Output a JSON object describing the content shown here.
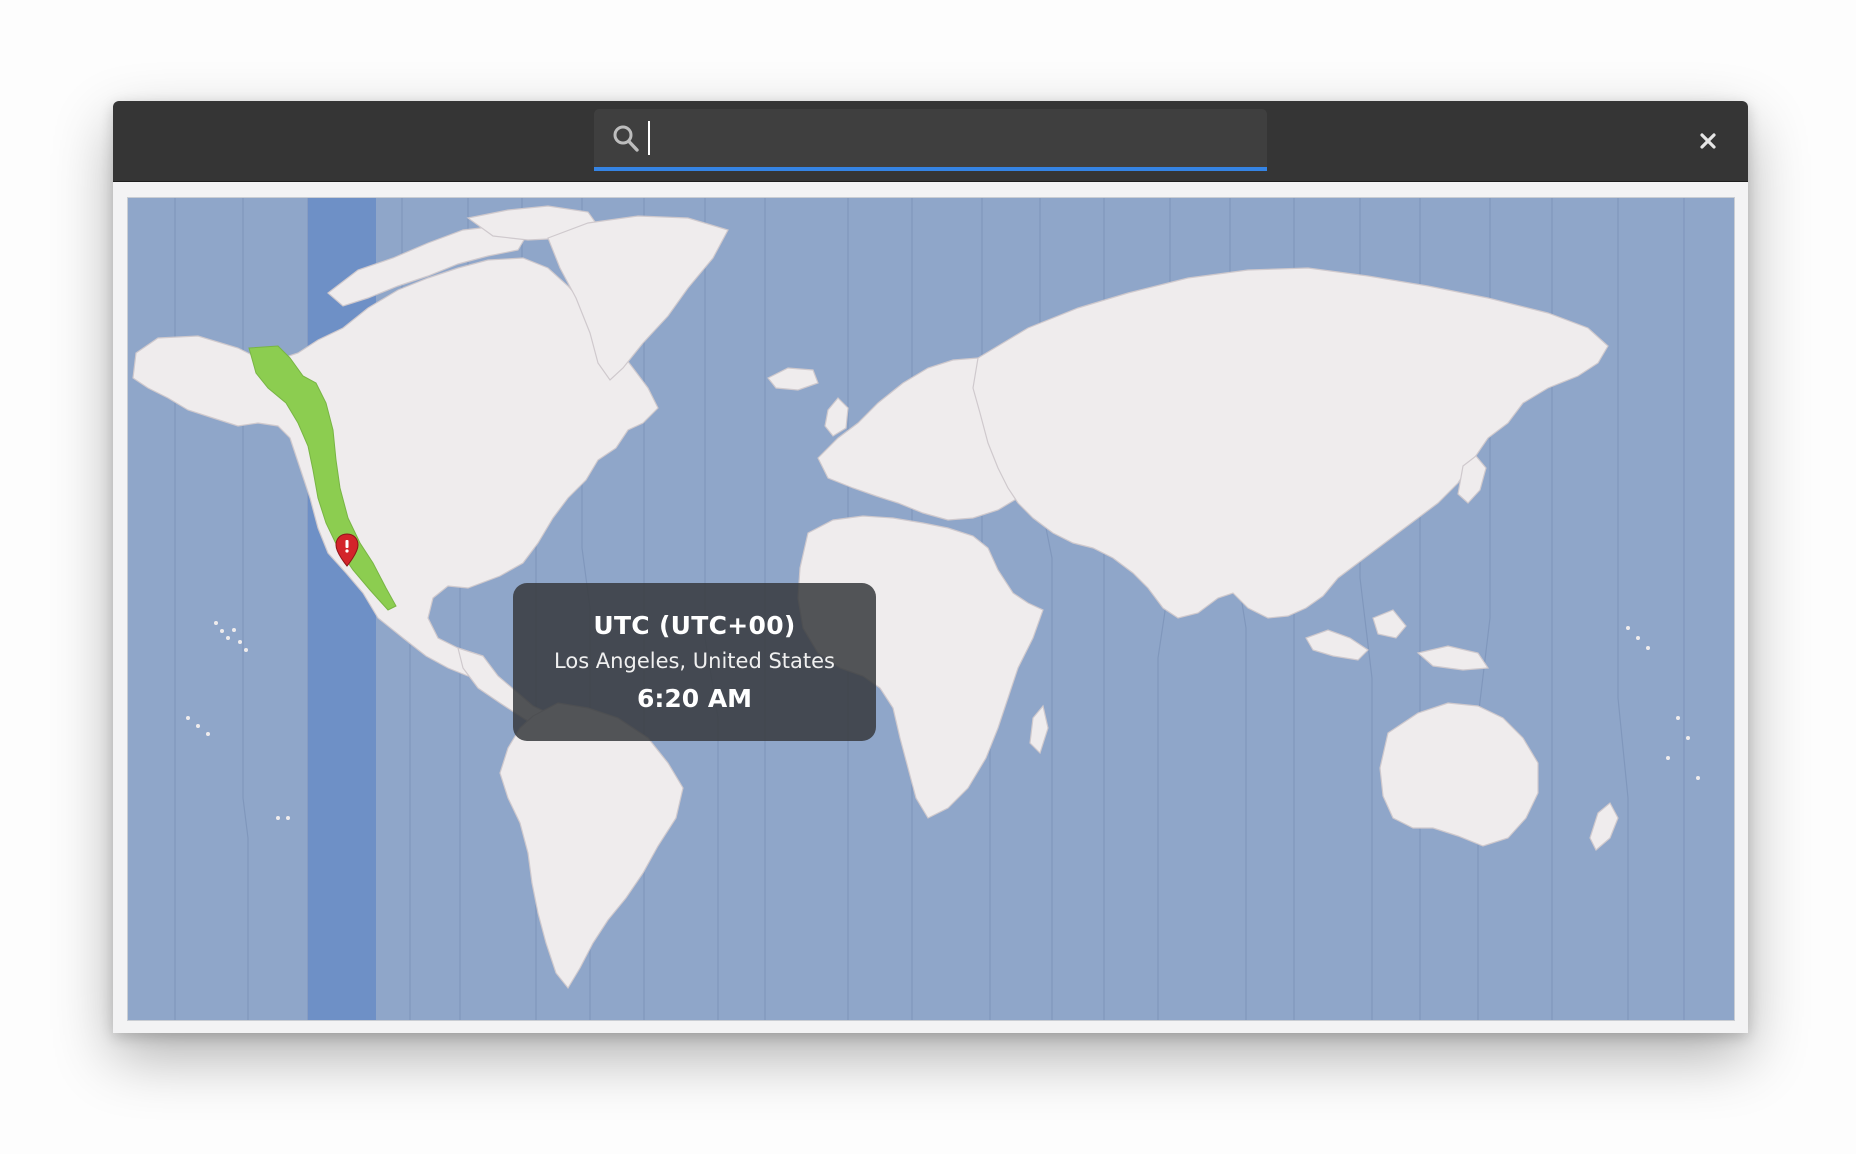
{
  "search": {
    "value": "",
    "placeholder": ""
  },
  "tooltip": {
    "timezone": "UTC (UTC+00)",
    "location": "Los Angeles, United States",
    "time": "6:20 AM"
  },
  "icons": {
    "search": "search-icon",
    "close": "close-icon",
    "pin": "map-pin-icon"
  },
  "colors": {
    "headerbar": "#353535",
    "search_accent": "#3584e4",
    "ocean": "#8fa6c9",
    "land": "#efeced",
    "highlight_band": "#6d8ec6",
    "selected_region": "#8ccd50",
    "pin": "#d3242a"
  }
}
